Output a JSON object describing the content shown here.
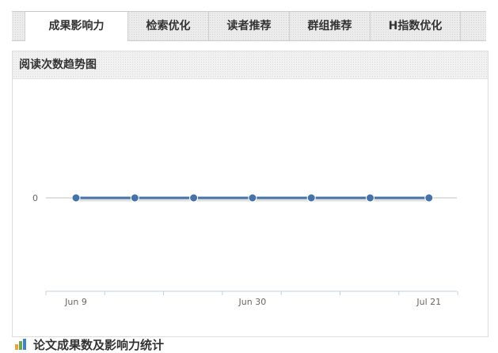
{
  "tabs": [
    {
      "label": "成果影响力",
      "active": true
    },
    {
      "label": "检索优化",
      "active": false
    },
    {
      "label": "读者推荐",
      "active": false
    },
    {
      "label": "群组推荐",
      "active": false
    },
    {
      "label": "H指数优化",
      "active": false
    }
  ],
  "panel": {
    "title": "阅读次数趋势图"
  },
  "chart_data": {
    "type": "line",
    "title": "",
    "xlabel": "",
    "ylabel": "",
    "x_tick_labels": [
      "Jun 9",
      "Jun 30",
      "Jul 21"
    ],
    "y_tick_labels": [
      "0"
    ],
    "x": [
      "Jun 9",
      "Jun 16",
      "Jun 23",
      "Jun 30",
      "Jul 7",
      "Jul 14",
      "Jul 21"
    ],
    "series": [
      {
        "values": [
          0,
          0,
          0,
          0,
          0,
          0,
          0
        ],
        "color": "#4572a7"
      }
    ],
    "grid": false,
    "legend": "none"
  },
  "section2": {
    "title": "论文成果数及影响力统计"
  },
  "colors": {
    "series": "#4572a7",
    "axis": "#c0d0e0",
    "icon_bars": [
      "#e8a33c",
      "#6aa84f",
      "#3d85c6"
    ]
  }
}
